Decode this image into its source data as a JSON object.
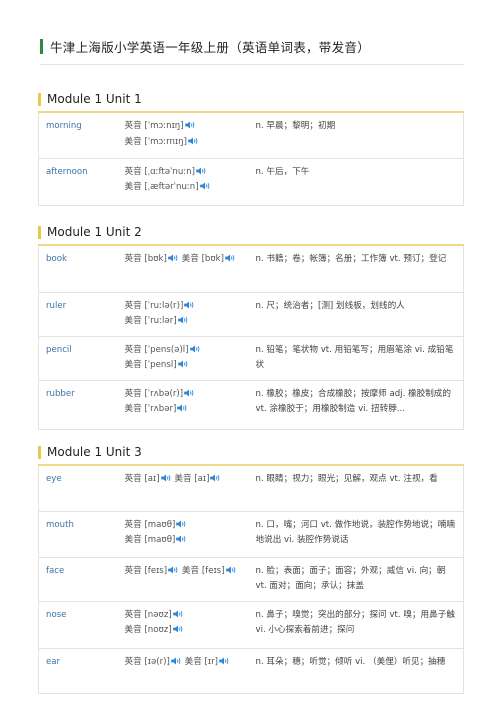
{
  "title": "牛津上海版小学英语一年级上册（英语单词表，带发音）",
  "colors": {
    "title_bar": "#2e8b3d",
    "unit_bar": "#e8c84a",
    "word": "#3a73a8",
    "speaker": "#2f86d6"
  },
  "units": [
    {
      "heading": "Module 1 Unit 1",
      "rows": [
        {
          "word": "morning",
          "pron": [
            [
              "英音",
              "[ˈmɔːnɪŋ]"
            ],
            [
              "美音",
              "[ˈmɔːrnɪŋ]"
            ]
          ],
          "def": "n. 早晨；黎明；初期"
        },
        {
          "word": "afternoon",
          "pron": [
            [
              "英音",
              "[ˌɑːftəˈnuːn]"
            ],
            [
              "美音",
              "[ˌæftərˈnuːn]"
            ]
          ],
          "def": "n. 午后，下午"
        }
      ]
    },
    {
      "heading": "Module 1 Unit 2",
      "rows": [
        {
          "word": "book",
          "pron": [
            [
              "英音",
              "[bʊk]",
              "美音",
              "[bʊk]"
            ]
          ],
          "def": "n. 书籍；卷；帐簿；名册；工作簿 vt. 预订；登记"
        },
        {
          "word": "ruler",
          "pron": [
            [
              "英音",
              "[ˈruːlə(r)]"
            ],
            [
              "美音",
              "[ˈruːlər]"
            ]
          ],
          "def": "n. 尺；统治者；[测] 划线板，划线的人"
        },
        {
          "word": "pencil",
          "pron": [
            [
              "英音",
              "[ˈpens(ə)l]"
            ],
            [
              "美音",
              "[ˈpensl]"
            ]
          ],
          "def": "n. 铅笔；笔状物 vt. 用铅笔写；用眉笔涂 vi. 成铅笔状"
        },
        {
          "word": "rubber",
          "pron": [
            [
              "英音",
              "[ˈrʌbə(r)]"
            ],
            [
              "美音",
              "[ˈrʌbər]"
            ]
          ],
          "def": "n. 橡胶；橡皮；合成橡胶；按摩师 adj. 橡胶制成的 vt. 涂橡胶于；用橡胶制造 vi. 扭转脖..."
        }
      ]
    },
    {
      "heading": "Module 1 Unit 3",
      "rows": [
        {
          "word": "eye",
          "pron": [
            [
              "英音",
              "[aɪ]",
              "美音",
              "[aɪ]"
            ]
          ],
          "def": "n. 眼睛；视力；眼光；见解，观点 vt. 注视，看"
        },
        {
          "word": "mouth",
          "pron": [
            [
              "英音",
              "[maʊθ]"
            ],
            [
              "美音",
              "[maʊθ]"
            ]
          ],
          "def": "n. 口，嘴；河口 vt. 做作地说，装腔作势地说；喃喃地说出 vi. 装腔作势说话"
        },
        {
          "word": "face",
          "pron": [
            [
              "英音",
              "[feɪs]",
              "美音",
              "[feɪs]"
            ]
          ],
          "def": "n. 脸；表面；面子；面容；外观；威信 vi. 向；朝 vt. 面对；面向；承认；抹盖"
        },
        {
          "word": "nose",
          "pron": [
            [
              "英音",
              "[nəʊz]"
            ],
            [
              "美音",
              "[noʊz]"
            ]
          ],
          "def": "n. 鼻子；嗅觉；突出的部分；探问 vt. 嗅；用鼻子触 vi. 小心探索着前进；探问"
        },
        {
          "word": "ear",
          "pron": [
            [
              "英音",
              "[ɪə(r)]",
              "美音",
              "[ɪr]"
            ]
          ],
          "def": "n. 耳朵；穗；听觉；倾听 vi. （美俚）听见；抽穗"
        }
      ]
    }
  ]
}
